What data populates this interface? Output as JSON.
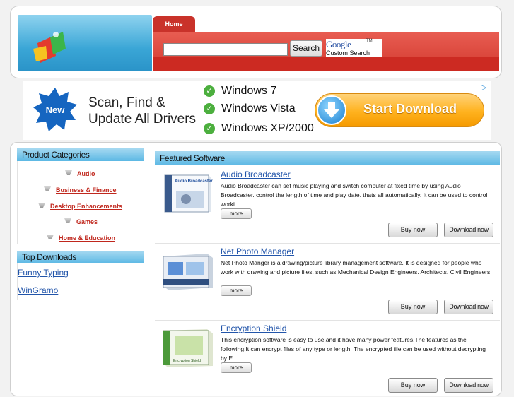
{
  "header": {
    "home_tab": "Home",
    "search_button": "Search",
    "search_value": "",
    "google_word": "Google",
    "google_tm": "TM",
    "custom_search": "Custom Search"
  },
  "ad": {
    "badge": "New",
    "headline_lines": [
      "Scan, Find &",
      "Update All Drivers"
    ],
    "os_list": [
      "Windows 7",
      "Windows Vista",
      "Windows XP/2000"
    ],
    "cta": "Start Download",
    "colors": {
      "check": "#4caf3e",
      "cta": "#ffb21e",
      "badge": "#1565c0"
    }
  },
  "sidebar": {
    "categories_title": "Product Categories",
    "categories": [
      "Audio",
      "Business & Finance",
      "Desktop Enhancements",
      "Games",
      "Home & Education"
    ],
    "top_title": "Top Downloads",
    "top_downloads": [
      "Funny Typing",
      "WinGramo"
    ]
  },
  "featured": {
    "title": "Featured Software",
    "more_label": "more",
    "buy_label": "Buy now",
    "download_label": "Download now",
    "items": [
      {
        "name": "Audio Broadcaster",
        "desc": "Audio Broadcaster can set music playing and switch computer at fixed time by using Audio Broadcaster. control the length of time and play date. thats all automatically. It can be used to control worki",
        "box_text": "Audio Broadcaster"
      },
      {
        "name": "Net Photo Manager",
        "desc": "Net Photo Manger is a drawing/picture library management software. It is designed for people who work with drawing and picture files. such as Mechanical Design Engineers. Architects. Civil Engineers.",
        "box_text": ""
      },
      {
        "name": "Encryption Shield",
        "desc": "This encryption software is easy to use.and it have many power features.The features as the following:It can encrypt files of any type or length. The encrypted file can be used without decrypting by E",
        "box_text": "Encryption Shield"
      }
    ]
  },
  "colors": {
    "accent_red": "#d33a2f",
    "panel_blue": "#5cb8e4",
    "link": "#2255aa",
    "category_link": "#c0271d"
  }
}
